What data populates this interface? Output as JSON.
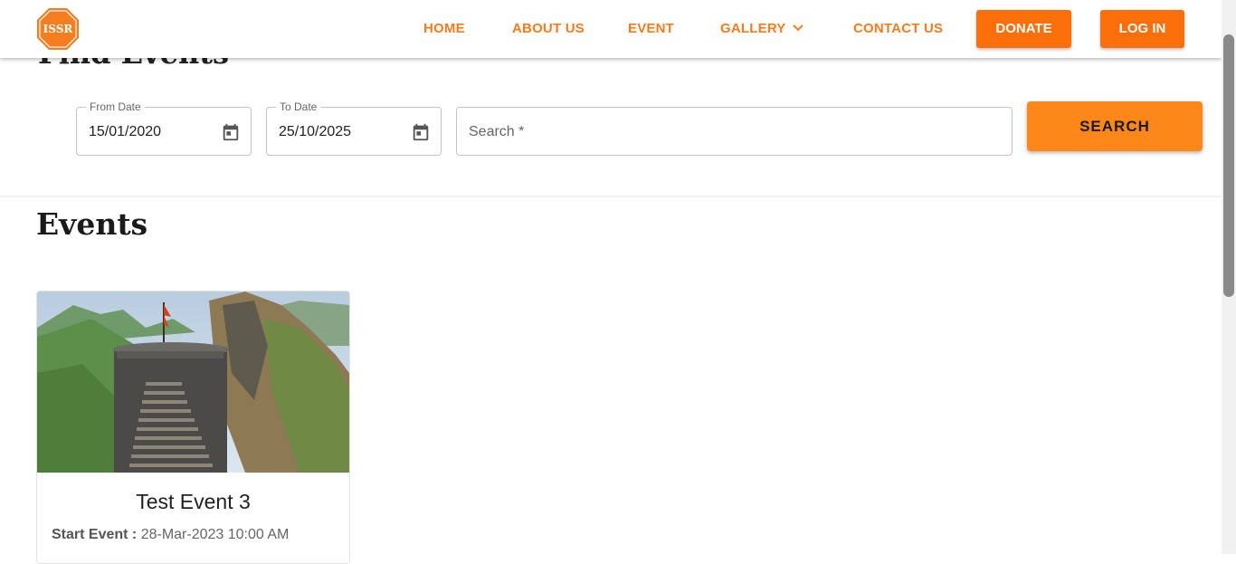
{
  "header": {
    "logo_text": "ISSR",
    "nav": {
      "home": "HOME",
      "about": "ABOUT US",
      "event": "EVENT",
      "gallery": "GALLERY",
      "contact": "CONTACT US"
    },
    "donate_label": "DONATE",
    "login_label": "LOG IN"
  },
  "find_events": {
    "title": "Find Events",
    "from_date_label": "From Date",
    "from_date_value": "15/01/2020",
    "to_date_label": "To Date",
    "to_date_value": "25/10/2025",
    "search_placeholder": "Search *",
    "search_button": "SEARCH"
  },
  "events": {
    "title": "Events",
    "cards": [
      {
        "title": "Test Event 3",
        "start_label": "Start Event :",
        "start_value": "28-Mar-2023 10:00 AM",
        "image_icon": "fort-stairs-photo"
      }
    ]
  },
  "colors": {
    "accent": "#f47c20",
    "button": "#fb6f0b",
    "search_button": "#fd8718"
  }
}
